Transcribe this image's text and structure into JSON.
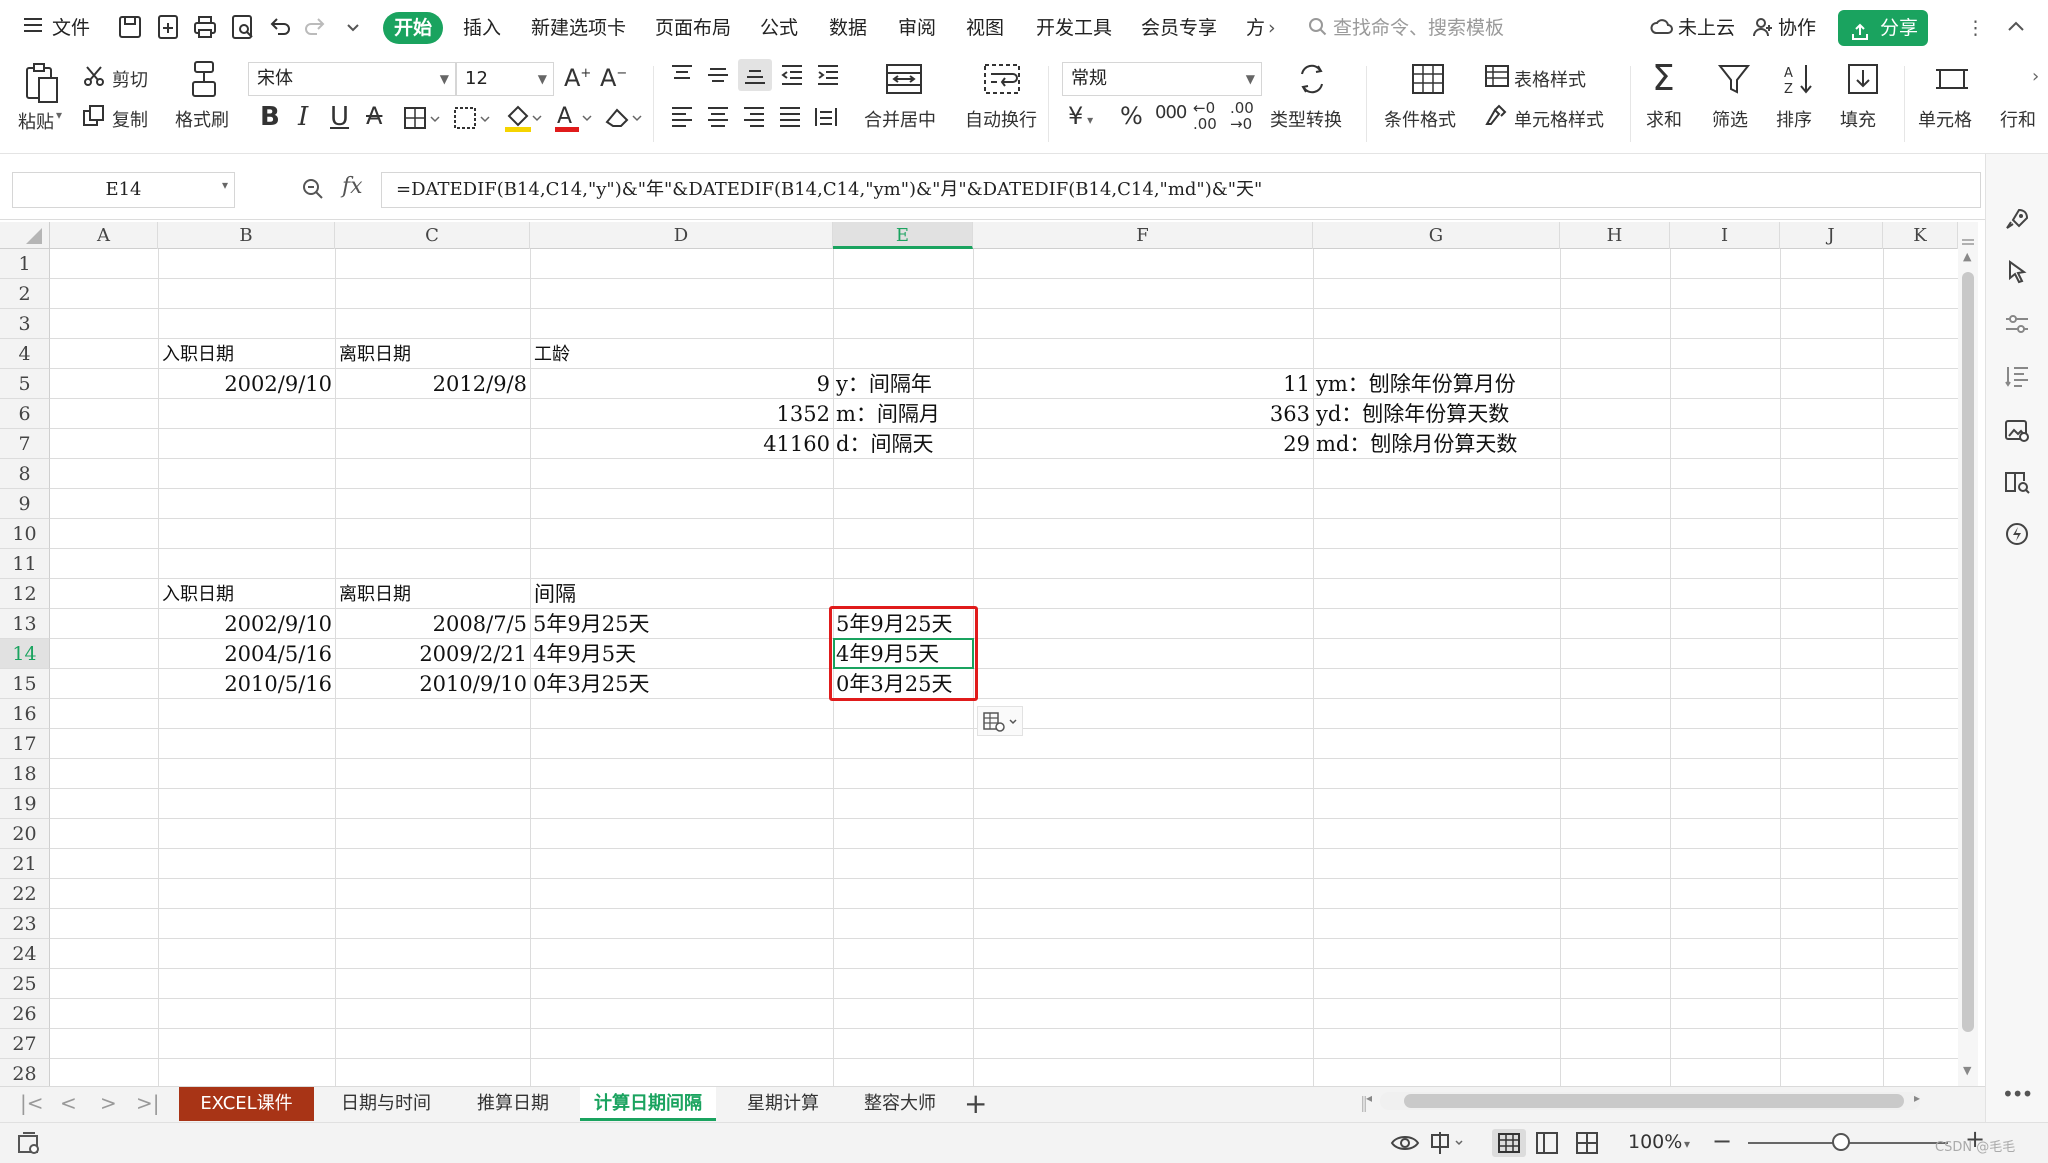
{
  "menubar": {
    "file_label": "文件",
    "tabs": [
      {
        "label": "开始"
      },
      {
        "label": "插入"
      },
      {
        "label": "新建选项卡"
      },
      {
        "label": "页面布局"
      },
      {
        "label": "公式"
      },
      {
        "label": "数据"
      },
      {
        "label": "审阅"
      },
      {
        "label": "视图"
      },
      {
        "label": "开发工具"
      },
      {
        "label": "会员专享"
      },
      {
        "label": "方"
      }
    ],
    "search_placeholder": "查找命令、搜索模板",
    "cloud_label": "未上云",
    "collab_label": "协作",
    "share_label": "分享",
    "accent_color": "#1aa35f"
  },
  "ribbon": {
    "paste": "粘贴",
    "cut": "剪切",
    "copy": "复制",
    "format_painter": "格式刷",
    "font_name": "宋体",
    "font_size": "12",
    "merge_center": "合并居中",
    "wrap_text": "自动换行",
    "number_format": "常规",
    "type_convert": "类型转换",
    "conditional_format": "条件格式",
    "table_style": "表格样式",
    "cell_style": "单元格样式",
    "sum": "求和",
    "filter": "筛选",
    "sort": "排序",
    "fill": "填充",
    "cell": "单元格",
    "row_col": "行和"
  },
  "formula_bar": {
    "name_box": "E14",
    "fx": "fx",
    "formula": "=DATEDIF(B14,C14,\"y\")&\"年\"&DATEDIF(B14,C14,\"ym\")&\"月\"&DATEDIF(B14,C14,\"md\")&\"天\""
  },
  "grid": {
    "columns": [
      "A",
      "B",
      "C",
      "D",
      "E",
      "F",
      "G",
      "H",
      "I",
      "J",
      "K"
    ],
    "selected_column": "E",
    "rows": [
      "1",
      "2",
      "3",
      "4",
      "5",
      "6",
      "7",
      "8",
      "9",
      "10",
      "11",
      "12",
      "13",
      "14",
      "15",
      "16",
      "17",
      "18",
      "19",
      "20",
      "21",
      "22",
      "23",
      "24",
      "25",
      "26",
      "27",
      "28"
    ],
    "selected_row": "14",
    "cells": {
      "B4": "入职日期",
      "C4": "离职日期",
      "D4": "工龄",
      "B5": "2002/9/10",
      "C5": "2012/9/8",
      "D5": "9",
      "E5": "y：间隔年",
      "F5": "11",
      "G5": "ym：刨除年份算月份",
      "D6": "1352",
      "E6": "m：间隔月",
      "F6": "363",
      "G6": "yd：刨除年份算天数",
      "D7": "41160",
      "E7": "d：间隔天",
      "F7": "29",
      "G7": "md：刨除月份算天数",
      "B12": "入职日期",
      "C12": "离职日期",
      "D12": "间隔",
      "B13": "2002/9/10",
      "C13": "2008/7/5",
      "D13": "5年9月25天",
      "E13": "5年9月25天",
      "B14": "2004/5/16",
      "C14": "2009/2/21",
      "D14": "4年9月5天",
      "E14": "4年9月5天",
      "B15": "2010/5/16",
      "C15": "2010/9/10",
      "D15": "0年3月25天",
      "E15": "0年3月25天"
    },
    "highlight_color": "#e01b1b"
  },
  "sheets": {
    "tabs": [
      {
        "label": "EXCEL课件"
      },
      {
        "label": "日期与时间"
      },
      {
        "label": "推算日期"
      },
      {
        "label": "计算日期间隔"
      },
      {
        "label": "星期计算"
      },
      {
        "label": "整容大师"
      }
    ],
    "active": "计算日期间隔"
  },
  "status": {
    "zoom": "100%",
    "watermark": "CSDN @毛毛"
  }
}
